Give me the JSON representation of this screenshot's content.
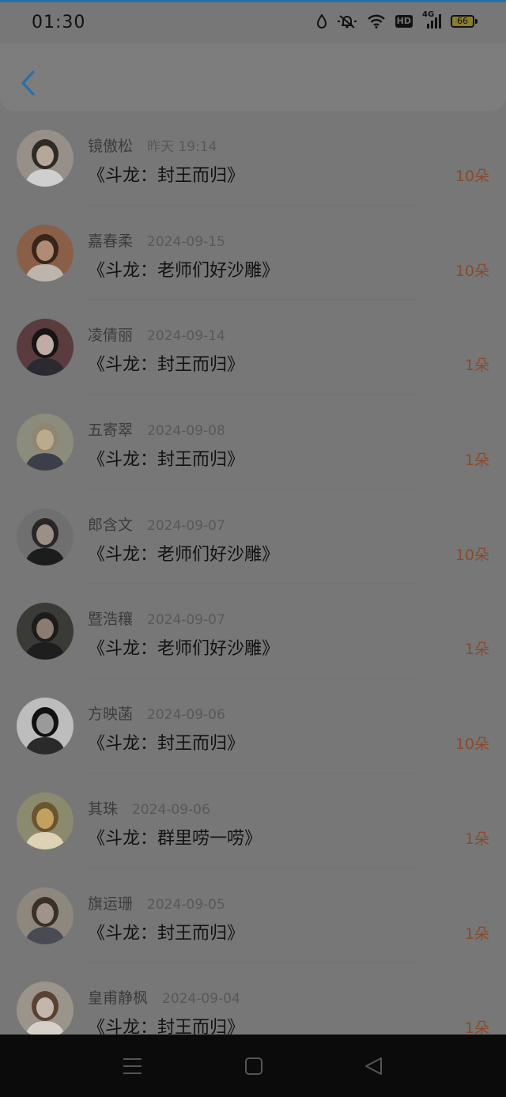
{
  "status_bar": {
    "time": "01:30",
    "hd_label": "HD",
    "network_label": "4G",
    "battery": "66",
    "icons": [
      "drop-icon",
      "mute-icon",
      "wifi-icon",
      "hd-icon",
      "signal-icon",
      "battery-icon"
    ]
  },
  "header": {
    "back_icon": "chevron-left-icon"
  },
  "records": [
    {
      "name": "镜傲松",
      "date": "昨天 19:14",
      "work": "《斗龙：封王而归》",
      "amount": "10朵",
      "avatar": {
        "skin": "#b7a79a",
        "hair": "#2e2a26",
        "bg": "#969088",
        "cloth": "#cfcfcf"
      }
    },
    {
      "name": "嘉春柔",
      "date": "2024-09-15",
      "work": "《斗龙：老师们好沙雕》",
      "amount": "10朵",
      "avatar": {
        "skin": "#b08c74",
        "hair": "#3a2519",
        "bg": "#8a5f47",
        "cloth": "#bdb4ac"
      }
    },
    {
      "name": "凌倩丽",
      "date": "2024-09-14",
      "work": "《斗龙：封王而归》",
      "amount": "1朵",
      "avatar": {
        "skin": "#c0aca4",
        "hair": "#161414",
        "bg": "#5a3b3e",
        "cloth": "#2a2a33"
      }
    },
    {
      "name": "五寄翠",
      "date": "2024-09-08",
      "work": "《斗龙：封王而归》",
      "amount": "1朵",
      "avatar": {
        "skin": "#b9ab8c",
        "hair": "#8f8570",
        "bg": "#8c8c7c",
        "cloth": "#3b3f4a"
      }
    },
    {
      "name": "郎含文",
      "date": "2024-09-07",
      "work": "《斗龙：老师们好沙雕》",
      "amount": "10朵",
      "avatar": {
        "skin": "#9b8f87",
        "hair": "#2a2626",
        "bg": "#6f6f6f",
        "cloth": "#1c1c1c"
      }
    },
    {
      "name": "暨浩穰",
      "date": "2024-09-07",
      "work": "《斗龙：老师们好沙雕》",
      "amount": "1朵",
      "avatar": {
        "skin": "#8a7c70",
        "hair": "#1e1c1a",
        "bg": "#3a3a36",
        "cloth": "#1e1e1e"
      }
    },
    {
      "name": "方映菡",
      "date": "2024-09-06",
      "work": "《斗龙：封王而归》",
      "amount": "10朵",
      "avatar": {
        "skin": "#9a9a9a",
        "hair": "#111111",
        "bg": "#bdbdbd",
        "cloth": "#2a2a2a"
      }
    },
    {
      "name": "其珠",
      "date": "2024-09-06",
      "work": "《斗龙：群里唠一唠》",
      "amount": "1朵",
      "avatar": {
        "skin": "#c2a060",
        "hair": "#6b5430",
        "bg": "#8c8a6e",
        "cloth": "#ddd2b5"
      }
    },
    {
      "name": "旗运珊",
      "date": "2024-09-05",
      "work": "《斗龙：封王而归》",
      "amount": "1朵",
      "avatar": {
        "skin": "#a0938a",
        "hair": "#3a302a",
        "bg": "#8d877e",
        "cloth": "#4a4a52"
      }
    },
    {
      "name": "皇甫静枫",
      "date": "2024-09-04",
      "work": "《斗龙：封王而归》",
      "amount": "1朵",
      "avatar": {
        "skin": "#c4b6ac",
        "hair": "#5a4232",
        "bg": "#9a948a",
        "cloth": "#d5d0c9"
      }
    }
  ],
  "nav": {
    "icons": [
      "menu-icon",
      "home-square-icon",
      "back-triangle-icon"
    ]
  },
  "colors": {
    "overlay_bg": "#777777",
    "header_bg": "#7d7d7d",
    "accent_blue": "#2a6fa4",
    "amount": "#8a4a2c"
  }
}
